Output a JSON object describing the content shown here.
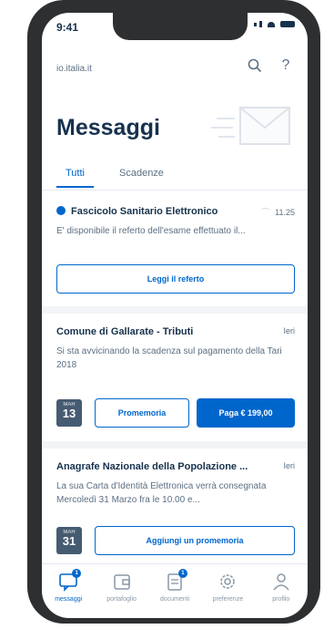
{
  "status": {
    "time": "9:41"
  },
  "header": {
    "url": "io.italia.it",
    "search_icon": "search-icon",
    "help_label": "?"
  },
  "title": "Messaggi",
  "tabs": [
    {
      "label": "Tutti",
      "active": true
    },
    {
      "label": "Scadenze",
      "active": false
    }
  ],
  "messages": [
    {
      "title": "Fascicolo Sanitario Elettronico",
      "time": "11.25",
      "text": "E' disponibile il referto dell'esame effettuato il...",
      "action": "Leggi il referto",
      "unread": true
    },
    {
      "title": "Comune di Gallarate - Tributi",
      "time": "Ieri",
      "text": "Si sta avvicinando la scadenza sul pagamento della Tari 2018",
      "calendar": {
        "month": "MAR",
        "day": "13"
      },
      "reminder_label": "Promemoria",
      "pay_label": "Paga € 199,00"
    },
    {
      "title": "Anagrafe Nazionale della Popolazione ...",
      "time": "Ieri",
      "text": "La sua Carta d'Identità Elettronica verrà consegnata Mercoledì 31 Marzo fra le 10.00 e...",
      "calendar": {
        "month": "MAR",
        "day": "31"
      },
      "action": "Aggiungi un promemoria"
    }
  ],
  "nav": [
    {
      "label": "messaggi",
      "icon": "messages-icon",
      "active": true,
      "badge": "1"
    },
    {
      "label": "portafoglio",
      "icon": "wallet-icon",
      "active": false
    },
    {
      "label": "documenti",
      "icon": "documents-icon",
      "active": false,
      "badge": "1"
    },
    {
      "label": "preferenze",
      "icon": "gear-icon",
      "active": false
    },
    {
      "label": "profilo",
      "icon": "profile-icon",
      "active": false
    }
  ],
  "colors": {
    "primary": "#0066cc",
    "text": "#17324d",
    "muted": "#5c6f82",
    "frame": "#2e2f31"
  }
}
